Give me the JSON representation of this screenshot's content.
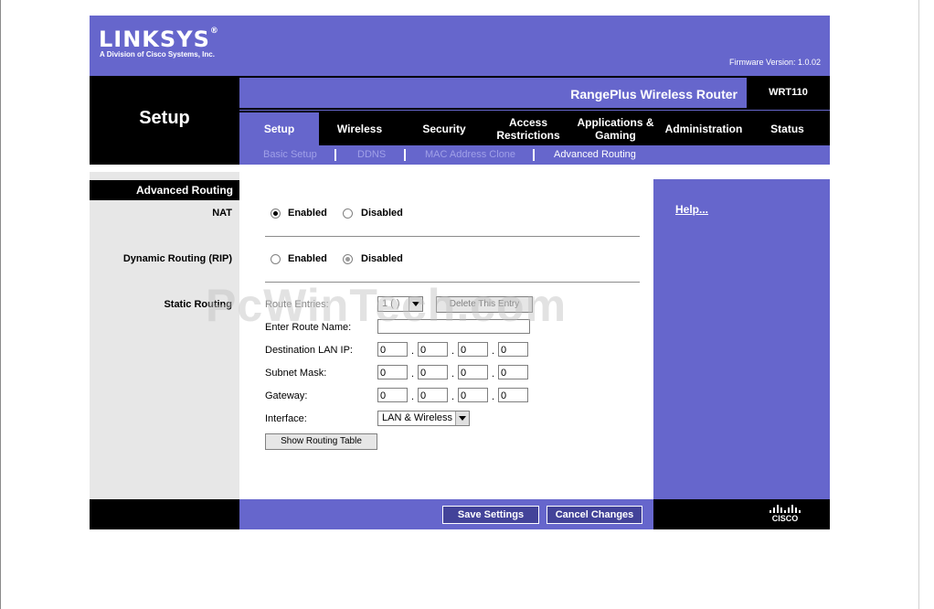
{
  "brand": {
    "logo": "LINKSYS",
    "logo_sub": "A Division of Cisco Systems, Inc.",
    "firmware": "Firmware Version: 1.0.02"
  },
  "section_title": "Setup",
  "product": {
    "name": "RangePlus Wireless Router",
    "model": "WRT110"
  },
  "tabs": [
    {
      "label": "Setup",
      "active": true
    },
    {
      "label": "Wireless"
    },
    {
      "label": "Security"
    },
    {
      "label": "Access Restrictions"
    },
    {
      "label": "Applications & Gaming"
    },
    {
      "label": "Administration"
    },
    {
      "label": "Status"
    }
  ],
  "subtabs": [
    {
      "label": "Basic Setup"
    },
    {
      "label": "DDNS"
    },
    {
      "label": "MAC Address Clone"
    },
    {
      "label": "Advanced Routing",
      "active": true
    }
  ],
  "sidebar": {
    "heading": "Advanced Routing",
    "nat_label": "NAT",
    "rip_label": "Dynamic Routing (RIP)",
    "static_label": "Static Routing"
  },
  "nat": {
    "enabled": "Enabled",
    "disabled": "Disabled",
    "selected": "enabled"
  },
  "rip": {
    "enabled": "Enabled",
    "disabled": "Disabled",
    "selected": "disabled"
  },
  "static_routing": {
    "route_entries_label": "Route Entries:",
    "route_entries_value": "1 ( )",
    "delete_button": "Delete This Entry",
    "route_name_label": "Enter Route Name:",
    "route_name_value": "",
    "dest_ip_label": "Destination LAN IP:",
    "dest_ip": [
      "0",
      "0",
      "0",
      "0"
    ],
    "subnet_label": "Subnet Mask:",
    "subnet": [
      "0",
      "0",
      "0",
      "0"
    ],
    "gateway_label": "Gateway:",
    "gateway": [
      "0",
      "0",
      "0",
      "0"
    ],
    "interface_label": "Interface:",
    "interface_value": "LAN & Wireless",
    "show_table_button": "Show Routing Table"
  },
  "help": "Help...",
  "footer": {
    "save": "Save Settings",
    "cancel": "Cancel Changes",
    "cisco": "CISCO"
  },
  "watermark": "PcWinTech.com",
  "colors": {
    "brand_purple": "#6666cc",
    "black": "#000000",
    "panel_grey": "#e7e7e7"
  }
}
